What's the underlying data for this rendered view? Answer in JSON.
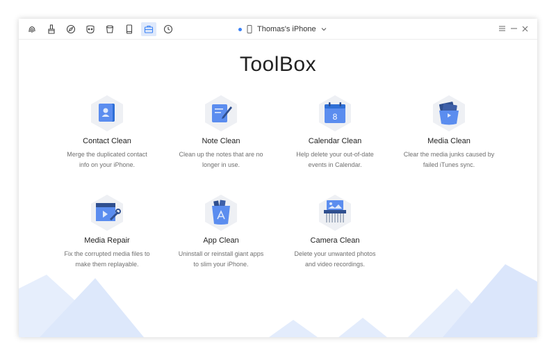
{
  "device": {
    "name": "Thomas's iPhone"
  },
  "page": {
    "title": "ToolBox"
  },
  "nav_icons": [
    "fingerprint-icon",
    "brush-icon",
    "compass-icon",
    "face-icon",
    "bucket-icon",
    "phone-icon",
    "toolbox-icon",
    "history-icon"
  ],
  "tools": [
    {
      "name": "Contact Clean",
      "desc1": "Merge the duplicated contact",
      "desc2": "info on your iPhone."
    },
    {
      "name": "Note Clean",
      "desc1": "Clean up the notes that are no",
      "desc2": "longer in use."
    },
    {
      "name": "Calendar Clean",
      "desc1": "Help delete your out-of-date",
      "desc2": "events in Calendar.",
      "badge": "8"
    },
    {
      "name": "Media Clean",
      "desc1": "Clear the media junks caused by",
      "desc2": "failed iTunes sync."
    },
    {
      "name": "Media Repair",
      "desc1": "Fix the corrupted media files to",
      "desc2": "make them replayable."
    },
    {
      "name": "App Clean",
      "desc1": "Uninstall or reinstall giant apps",
      "desc2": "to slim your iPhone."
    },
    {
      "name": "Camera Clean",
      "desc1": "Delete your unwanted photos",
      "desc2": "and video recordings."
    }
  ],
  "colors": {
    "accent": "#3b82f6",
    "icon_blue": "#5b8def",
    "hex_bg": "#eef0f4",
    "mountain": "#dbe8fb"
  }
}
